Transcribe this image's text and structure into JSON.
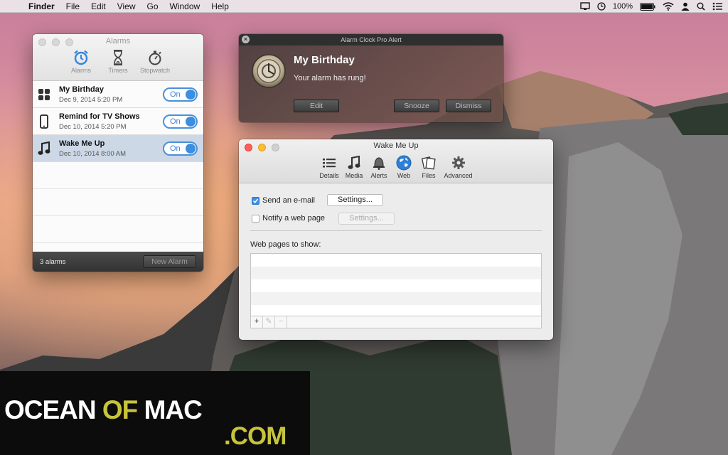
{
  "menubar": {
    "app": "Finder",
    "items": [
      "File",
      "Edit",
      "View",
      "Go",
      "Window",
      "Help"
    ],
    "battery": "100%"
  },
  "alarms_window": {
    "title": "Alarms",
    "tools": [
      {
        "label": "Alarms",
        "icon": "alarm-clock-icon"
      },
      {
        "label": "Timers",
        "icon": "hourglass-icon"
      },
      {
        "label": "Stopwatch",
        "icon": "stopwatch-icon"
      }
    ],
    "alarms": [
      {
        "name": "My Birthday",
        "date": "Dec 9, 2014 5:20 PM",
        "toggle": "On",
        "icon": "app-grid-icon"
      },
      {
        "name": "Remind for TV Shows",
        "date": "Dec 10, 2014 5:20 PM",
        "toggle": "On",
        "icon": "iphone-icon"
      },
      {
        "name": "Wake Me Up",
        "date": "Dec 10, 2014 8:00 AM",
        "toggle": "On",
        "icon": "music-note-icon"
      }
    ],
    "count": "3 alarms",
    "new_alarm": "New Alarm"
  },
  "alert_window": {
    "title": "Alarm Clock Pro Alert",
    "heading": "My Birthday",
    "message": "Your alarm has rung!",
    "edit": "Edit",
    "snooze": "Snooze",
    "dismiss": "Dismiss"
  },
  "wake_window": {
    "title": "Wake Me Up",
    "tools": [
      {
        "label": "Details",
        "icon": "list-icon"
      },
      {
        "label": "Media",
        "icon": "music-note-icon"
      },
      {
        "label": "Alerts",
        "icon": "bell-icon"
      },
      {
        "label": "Web",
        "icon": "globe-icon"
      },
      {
        "label": "Files",
        "icon": "files-icon"
      },
      {
        "label": "Advanced",
        "icon": "gear-icon"
      }
    ],
    "send_email": "Send an e-mail",
    "send_email_checked": true,
    "notify_web": "Notify a web page",
    "notify_web_checked": false,
    "settings": "Settings...",
    "web_pages_label": "Web pages to show:",
    "add": "+",
    "edit": "✎",
    "remove": "−"
  },
  "watermark": {
    "part1": "OCEAN",
    "part2": "OF",
    "part3": "MAC",
    "part4": ".COM"
  },
  "colors": {
    "accent": "#3d8ee0",
    "watermark_green": "#c7c43c"
  }
}
